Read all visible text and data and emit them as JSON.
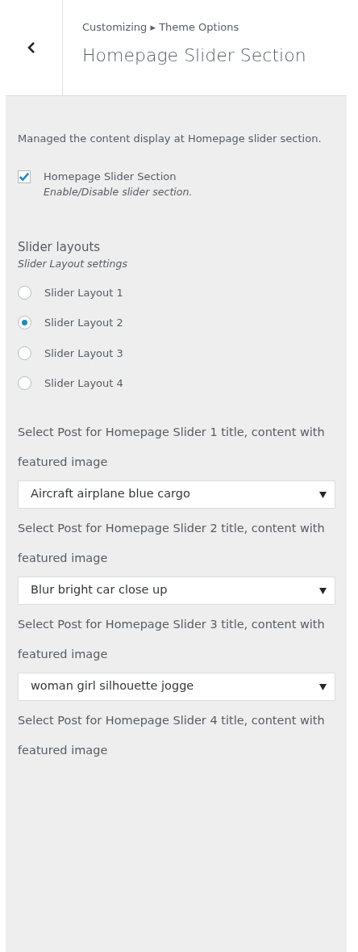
{
  "header": {
    "breadcrumb": "Customizing ▸ Theme Options",
    "title": "Homepage Slider Section"
  },
  "description": "Managed the content display at Homepage slider section.",
  "toggle": {
    "label": "Homepage Slider Section",
    "hint": "Enable/Disable slider section.",
    "checked": true
  },
  "layouts": {
    "title": "Slider layouts",
    "hint": "Slider Layout settings",
    "options": [
      {
        "label": "Slider Layout 1",
        "selected": false
      },
      {
        "label": "Slider Layout 2",
        "selected": true
      },
      {
        "label": "Slider Layout 3",
        "selected": false
      },
      {
        "label": "Slider Layout 4",
        "selected": false
      }
    ]
  },
  "post_selects": [
    {
      "label": "Select Post for Homepage Slider 1 title, content with featured image",
      "value": "Aircraft airplane blue cargo"
    },
    {
      "label": "Select Post for Homepage Slider 2 title, content with featured image",
      "value": "Blur bright car close up"
    },
    {
      "label": "Select Post for Homepage Slider 3 title, content with featured image",
      "value": "woman girl silhouette jogge"
    },
    {
      "label": "Select Post for Homepage Slider 4 title, content with featured image"
    }
  ]
}
